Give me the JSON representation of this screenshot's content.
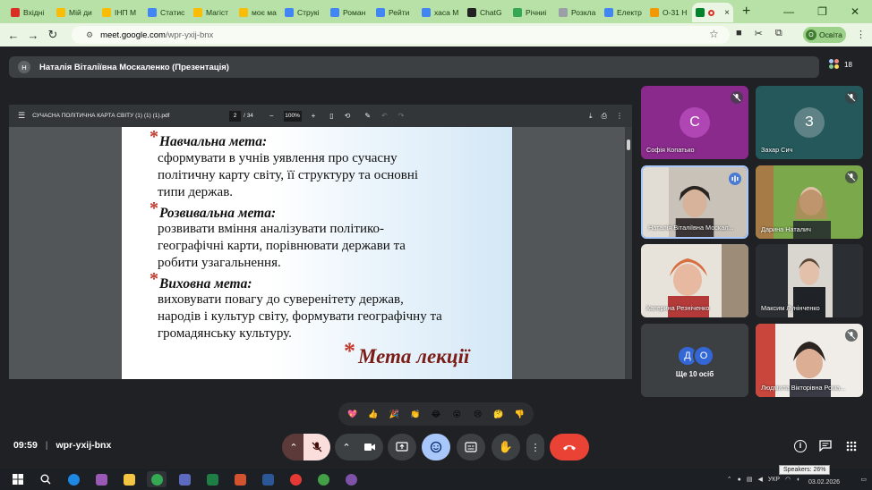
{
  "tabs": [
    {
      "label": "Вхідні",
      "color": "#d93025"
    },
    {
      "label": "Мій ди",
      "color": "#fbbc04"
    },
    {
      "label": "ІНП М",
      "color": "#fbbc04"
    },
    {
      "label": "Статис",
      "color": "#4285f4"
    },
    {
      "label": "Магіст",
      "color": "#fbbc04"
    },
    {
      "label": "моє ма",
      "color": "#fbbc04"
    },
    {
      "label": "Струкі",
      "color": "#4285f4"
    },
    {
      "label": "Роман",
      "color": "#4285f4"
    },
    {
      "label": "Рейти",
      "color": "#4285f4"
    },
    {
      "label": "хаса М",
      "color": "#4285f4"
    },
    {
      "label": "ChatG",
      "color": "#222222"
    },
    {
      "label": "Річниі",
      "color": "#34a853"
    },
    {
      "label": "Розкла",
      "color": "#9aa0a6"
    },
    {
      "label": "Електр",
      "color": "#4285f4"
    },
    {
      "label": "О-31 Н",
      "color": "#f29900"
    }
  ],
  "active_tab_close": "×",
  "new_tab": "+",
  "window_controls": {
    "minimize": "—",
    "maximize": "❐",
    "close": "✕"
  },
  "address": {
    "domain": "meet.google.com",
    "path": "/wpr-yxij-bnx"
  },
  "profile": {
    "initial": "О",
    "label": "Освіта"
  },
  "presenter_bar": {
    "initial": "Н",
    "title": "Наталія Віталіївна Москаленко (Презентація)"
  },
  "participant_count": "18",
  "pdf": {
    "filename": "СУЧАСНА ПОЛІТИЧНА КАРТА СВІТУ (1) (1) (1).pdf",
    "page": "2",
    "total_pages": "/ 34",
    "zoom": "100%",
    "zoom_out": "−",
    "zoom_in": "+"
  },
  "slide": {
    "h1": "Навчальна мета:",
    "l1": "сформувати в учнів уявлення про сучасну",
    "l2": "політичну карту світу, її структуру та основні",
    "l3": "типи держав.",
    "h2": "Розвивальна мета:",
    "l4": "розвивати вміння аналізувати політико-",
    "l5": "географічні карти, порівнювати держави та",
    "l6": "робити узагальнення.",
    "h3": "Виховна мета:",
    "l7": "виховувати повагу до суверенітету держав,",
    "l8": "народів і культур світу, формувати географічну та",
    "l9": "громадянську культуру.",
    "mark": "*",
    "footer": "Мета лекції"
  },
  "participants": {
    "p1": {
      "name": "Софія Копатько",
      "initial": "С"
    },
    "p2": {
      "name": "Захар Сич",
      "initial": "З"
    },
    "p3": {
      "name": "Наталія Віталіївна Москал..."
    },
    "p4": {
      "name": "Дарина Наталич"
    },
    "p5": {
      "name": "Катерина Резніченко"
    },
    "p6": {
      "name": "Максим Лунінченко"
    },
    "p7": {
      "label": "Ще 10 осіб",
      "a1": "Д",
      "a2": "О"
    },
    "p8": {
      "name": "Людмила Вікторівна Рома..."
    }
  },
  "reactions": [
    "💖",
    "👍",
    "🎉",
    "👏",
    "😂",
    "😮",
    "😢",
    "🤔",
    "👎"
  ],
  "footer": {
    "time": "09:59",
    "separator": "|",
    "code": "wpr-yxij-bnx"
  },
  "tray": {
    "lang": "УКР",
    "date": "03.02.2026",
    "speakers": "Speakers: 26%"
  }
}
